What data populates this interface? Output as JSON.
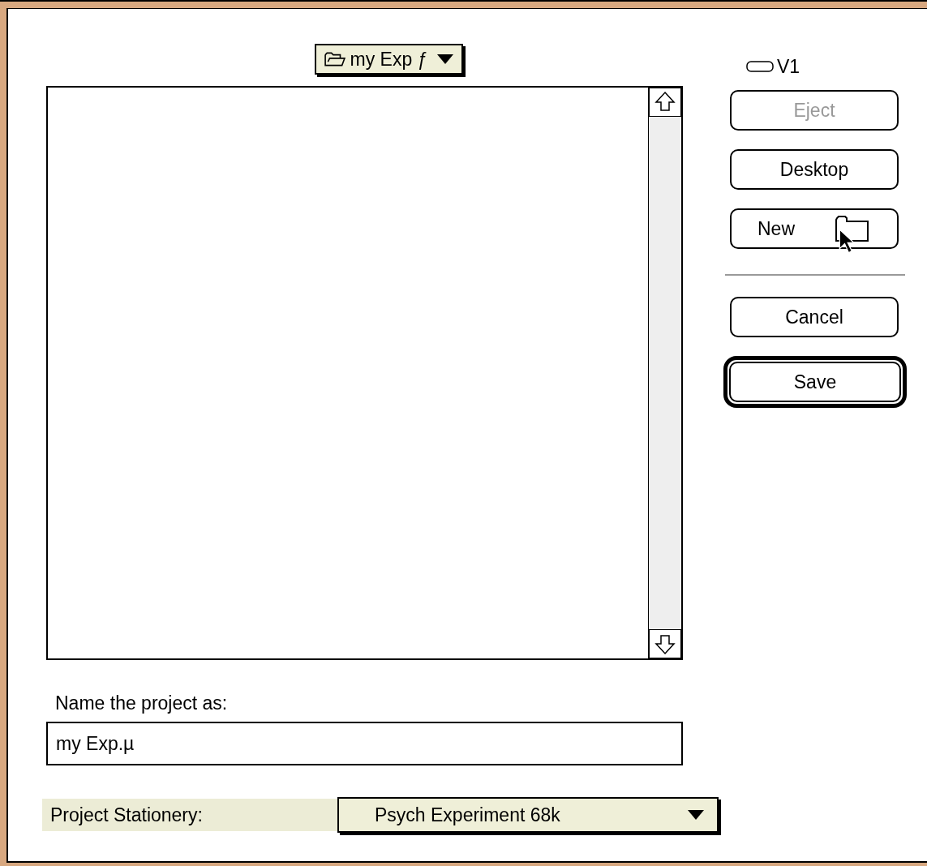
{
  "folder_menu": {
    "label": "my Exp ƒ"
  },
  "volume": {
    "label": "V1"
  },
  "buttons": [
    {
      "label": "Eject",
      "kind": "text",
      "disabled": true,
      "default": false
    },
    {
      "label": "Desktop",
      "kind": "text",
      "disabled": false,
      "default": false
    },
    {
      "label": "New",
      "kind": "folder",
      "disabled": false,
      "default": false
    }
  ],
  "action_buttons": [
    {
      "label": "Cancel",
      "disabled": false,
      "default": false
    },
    {
      "label": "Save",
      "disabled": false,
      "default": true
    }
  ],
  "name_field": {
    "label": "Name the project as:",
    "value": "my Exp.µ"
  },
  "stationery": {
    "label": "Project Stationery:",
    "value": "Psych Experiment 68k"
  }
}
